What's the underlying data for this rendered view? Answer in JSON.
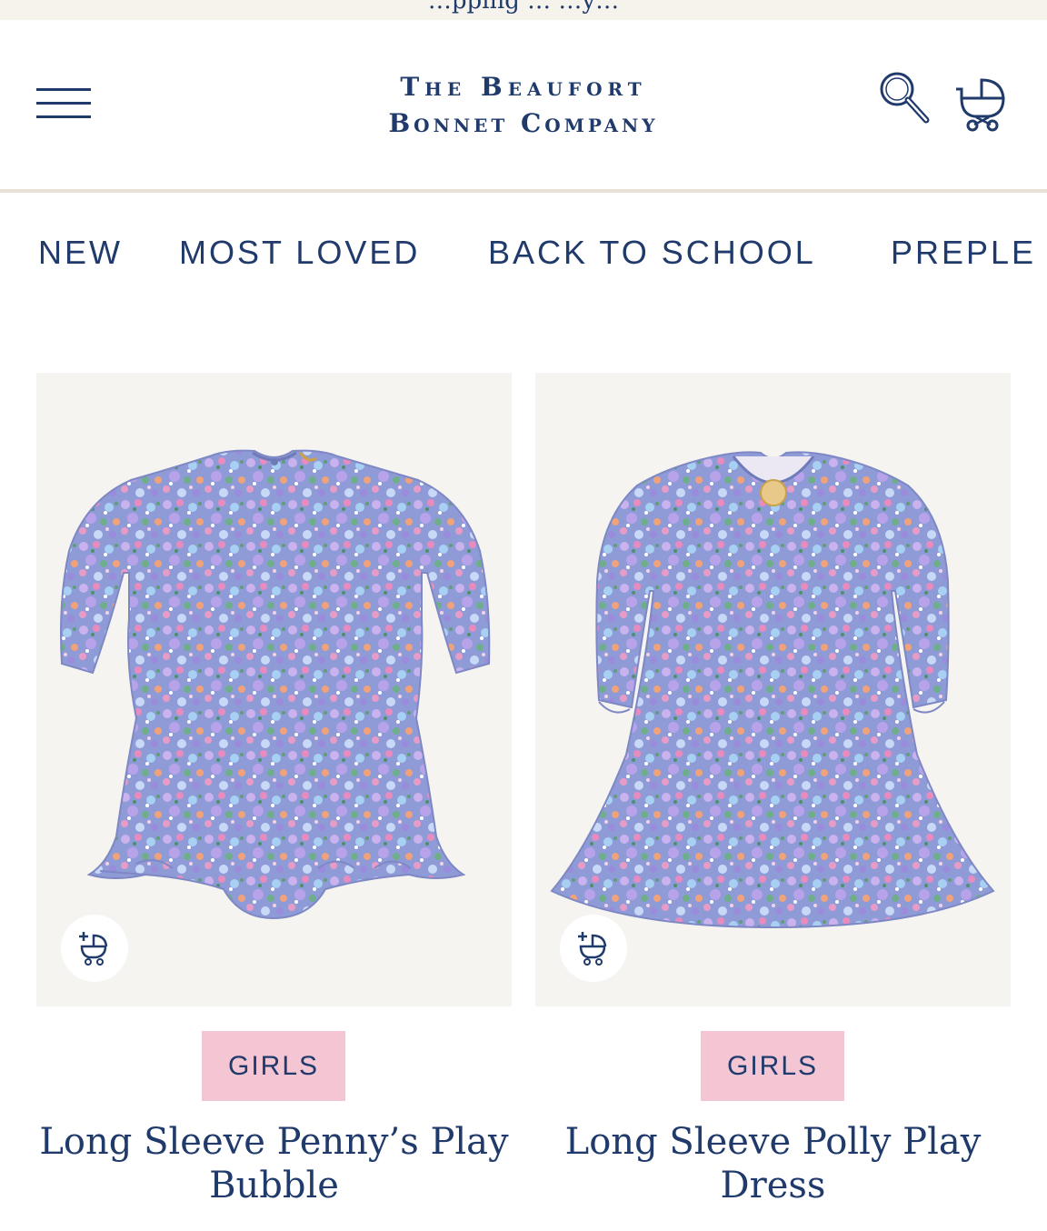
{
  "promo": {
    "text": "…pping … …y…"
  },
  "header": {
    "logo_line1": "The Beaufort",
    "logo_line2": "Bonnet Company",
    "menu_icon": "hamburger-menu-icon",
    "search_icon": "magnifying-glass-icon",
    "cart_icon": "baby-carriage-icon"
  },
  "nav": {
    "items": [
      {
        "label": "NEW"
      },
      {
        "label": "MOST LOVED"
      },
      {
        "label": "BACK TO SCHOOL"
      },
      {
        "label": "PREPLE"
      }
    ]
  },
  "products": [
    {
      "category": "GIRLS",
      "title_line1": "Long Sleeve Penny’s Play",
      "title_line2": "Bubble",
      "quick_add_icon": "add-to-cart-carriage-icon"
    },
    {
      "category": "GIRLS",
      "title_line1": "Long Sleeve Polly Play",
      "title_line2": "Dress",
      "quick_add_icon": "add-to-cart-carriage-icon"
    }
  ],
  "colors": {
    "brand_navy": "#1f3a6b",
    "badge_pink": "#f4c6d4",
    "image_bg": "#f6f4f1",
    "floral_base": "#8f9bd6"
  }
}
